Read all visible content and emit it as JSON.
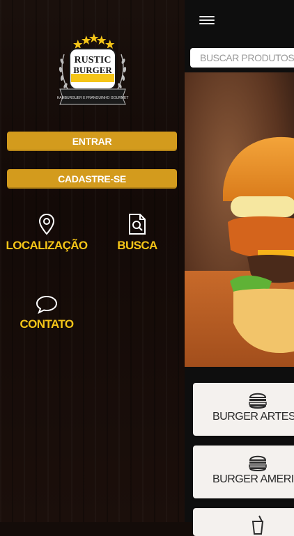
{
  "brand": {
    "logo_word1": "RUSTIC",
    "logo_word2": "BURGER",
    "logo_tagline": "HAMBURGUER E FRANGUINHO GOURMET",
    "star_count": 5
  },
  "drawer": {
    "login_label": "ENTRAR",
    "signup_label": "CADASTRE-SE",
    "tiles": [
      {
        "label": "LOCALIZAÇÃO",
        "icon": "location-pin-icon"
      },
      {
        "label": "BUSCA",
        "icon": "search-document-icon"
      },
      {
        "label": "CONTATO",
        "icon": "chat-bubble-icon"
      }
    ]
  },
  "main": {
    "search_placeholder": "BUSCAR PRODUTOS O",
    "categories": [
      {
        "label": "BURGER ARTESAN",
        "icon": "burger-icon"
      },
      {
        "label": "BURGER AMERICAI",
        "icon": "burger-icon"
      },
      {
        "label": "",
        "icon": "drink-icon"
      }
    ]
  },
  "colors": {
    "accent": "#d39b1d",
    "tile_text": "#f5c518",
    "background": "#140c09",
    "card": "#f4f1ee"
  }
}
